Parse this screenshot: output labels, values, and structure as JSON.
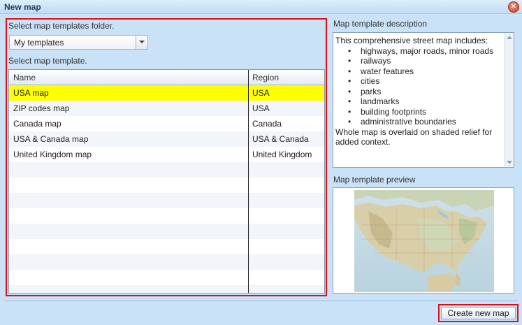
{
  "window": {
    "title": "New map"
  },
  "left": {
    "folder_label": "Select map templates folder.",
    "folder_select_value": "My templates",
    "template_label": "Select map template.",
    "table": {
      "columns": [
        "Name",
        "Region"
      ],
      "rows": [
        {
          "name": "USA map",
          "region": "USA",
          "selected": true
        },
        {
          "name": "ZIP codes map",
          "region": "USA"
        },
        {
          "name": "Canada map",
          "region": "Canada"
        },
        {
          "name": "USA & Canada map",
          "region": "USA & Canada"
        },
        {
          "name": "United Kingdom map",
          "region": "United Kingdom"
        }
      ]
    }
  },
  "right": {
    "description_label": "Map template description",
    "description_intro": "This comprehensive street map includes:",
    "description_items": [
      "highways, major roads, minor roads",
      "railways",
      "water features",
      "cities",
      "parks",
      "landmarks",
      "building footprints",
      "administrative boundaries"
    ],
    "description_outro": "Whole map is overlaid on shaded relief for added context.",
    "preview_label": "Map template preview"
  },
  "footer": {
    "create_button": "Create new map"
  },
  "colors": {
    "selection": "#ffff00",
    "highlight_border": "#e01010",
    "background": "#c9e2f7"
  }
}
